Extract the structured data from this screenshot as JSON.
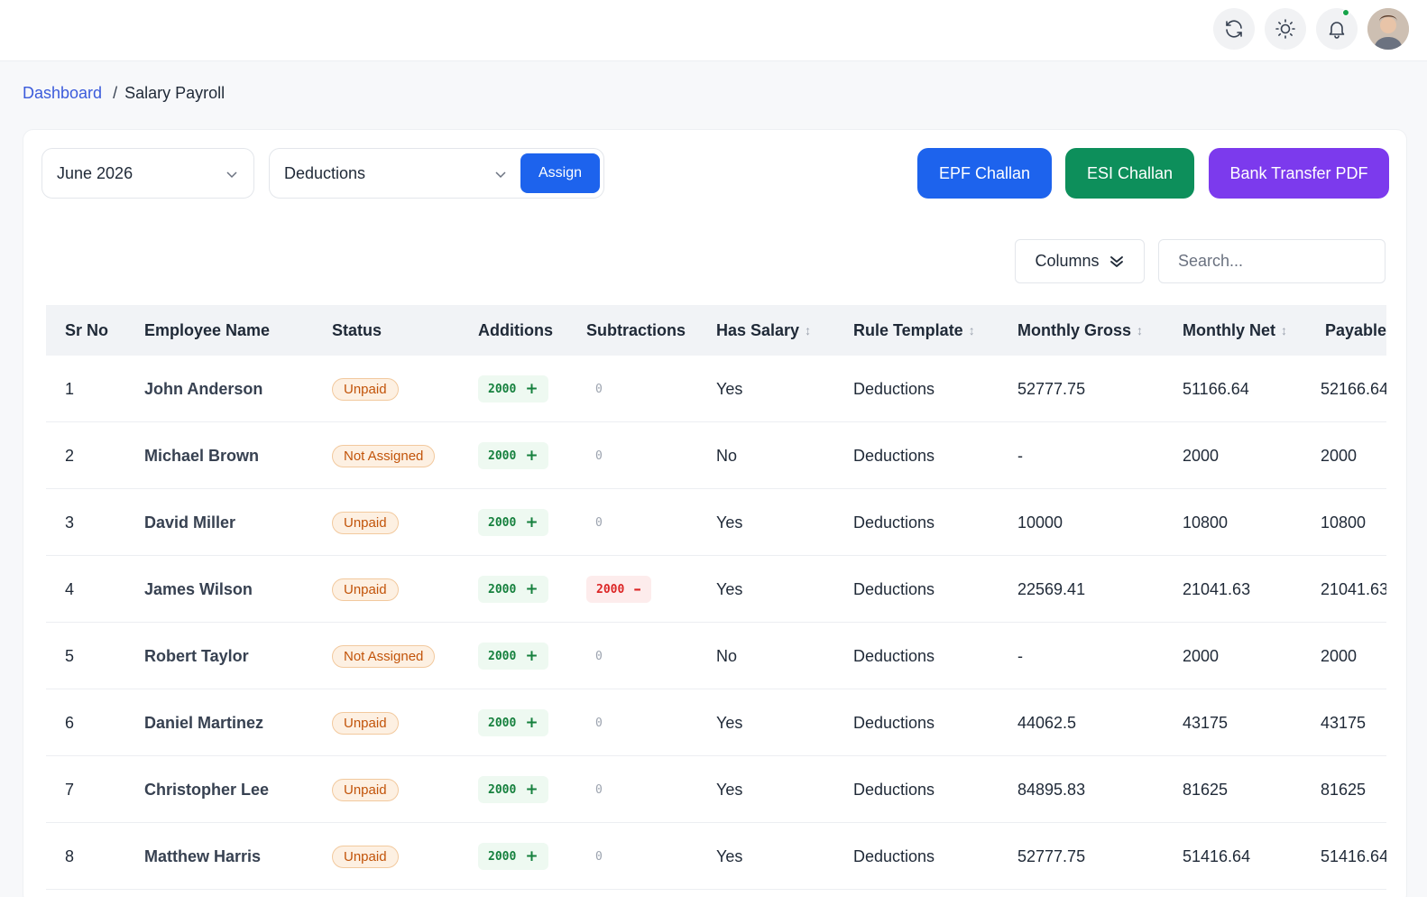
{
  "breadcrumb": {
    "home": "Dashboard",
    "separator": "/",
    "current": "Salary Payroll"
  },
  "filters": {
    "month": "June 2026",
    "template": "Deductions",
    "assign_label": "Assign"
  },
  "actions": {
    "epf": {
      "label": "EPF Challan",
      "color": "#1d63ed"
    },
    "esi": {
      "label": "ESI Challan",
      "color": "#0d8f5b"
    },
    "bank": {
      "label": "Bank Transfer PDF",
      "color": "#7c3aed"
    }
  },
  "toolbar": {
    "columns_label": "Columns",
    "search_placeholder": "Search..."
  },
  "table": {
    "headers": {
      "sr": "Sr No",
      "name": "Employee Name",
      "status": "Status",
      "additions": "Additions",
      "subtractions": "Subtractions",
      "has_salary": "Has Salary",
      "rule_template": "Rule Template",
      "monthly_gross": "Monthly Gross",
      "monthly_net": "Monthly Net",
      "payable": "Payable"
    },
    "rows": [
      {
        "sr": "1",
        "name": "John Anderson",
        "status": "Unpaid",
        "additions": "2000",
        "subtractions": "0",
        "has_salary": "Yes",
        "rule_template": "Deductions",
        "monthly_gross": "52777.75",
        "monthly_net": "51166.64",
        "payable": "52166.64"
      },
      {
        "sr": "2",
        "name": "Michael Brown",
        "status": "Not Assigned",
        "additions": "2000",
        "subtractions": "0",
        "has_salary": "No",
        "rule_template": "Deductions",
        "monthly_gross": "-",
        "monthly_net": "2000",
        "payable": "2000"
      },
      {
        "sr": "3",
        "name": "David Miller",
        "status": "Unpaid",
        "additions": "2000",
        "subtractions": "0",
        "has_salary": "Yes",
        "rule_template": "Deductions",
        "monthly_gross": "10000",
        "monthly_net": "10800",
        "payable": "10800"
      },
      {
        "sr": "4",
        "name": "James Wilson",
        "status": "Unpaid",
        "additions": "2000",
        "subtractions": "2000",
        "has_salary": "Yes",
        "rule_template": "Deductions",
        "monthly_gross": "22569.41",
        "monthly_net": "21041.63",
        "payable": "21041.63"
      },
      {
        "sr": "5",
        "name": "Robert Taylor",
        "status": "Not Assigned",
        "additions": "2000",
        "subtractions": "0",
        "has_salary": "No",
        "rule_template": "Deductions",
        "monthly_gross": "-",
        "monthly_net": "2000",
        "payable": "2000"
      },
      {
        "sr": "6",
        "name": "Daniel Martinez",
        "status": "Unpaid",
        "additions": "2000",
        "subtractions": "0",
        "has_salary": "Yes",
        "rule_template": "Deductions",
        "monthly_gross": "44062.5",
        "monthly_net": "43175",
        "payable": "43175"
      },
      {
        "sr": "7",
        "name": "Christopher Lee",
        "status": "Unpaid",
        "additions": "2000",
        "subtractions": "0",
        "has_salary": "Yes",
        "rule_template": "Deductions",
        "monthly_gross": "84895.83",
        "monthly_net": "81625",
        "payable": "81625"
      },
      {
        "sr": "8",
        "name": "Matthew Harris",
        "status": "Unpaid",
        "additions": "2000",
        "subtractions": "0",
        "has_salary": "Yes",
        "rule_template": "Deductions",
        "monthly_gross": "52777.75",
        "monthly_net": "51416.64",
        "payable": "51416.64"
      }
    ]
  },
  "icons": {
    "refresh": "refresh-icon",
    "theme": "sun-icon",
    "notifications": "bell-icon",
    "sort": "sort-icon"
  }
}
